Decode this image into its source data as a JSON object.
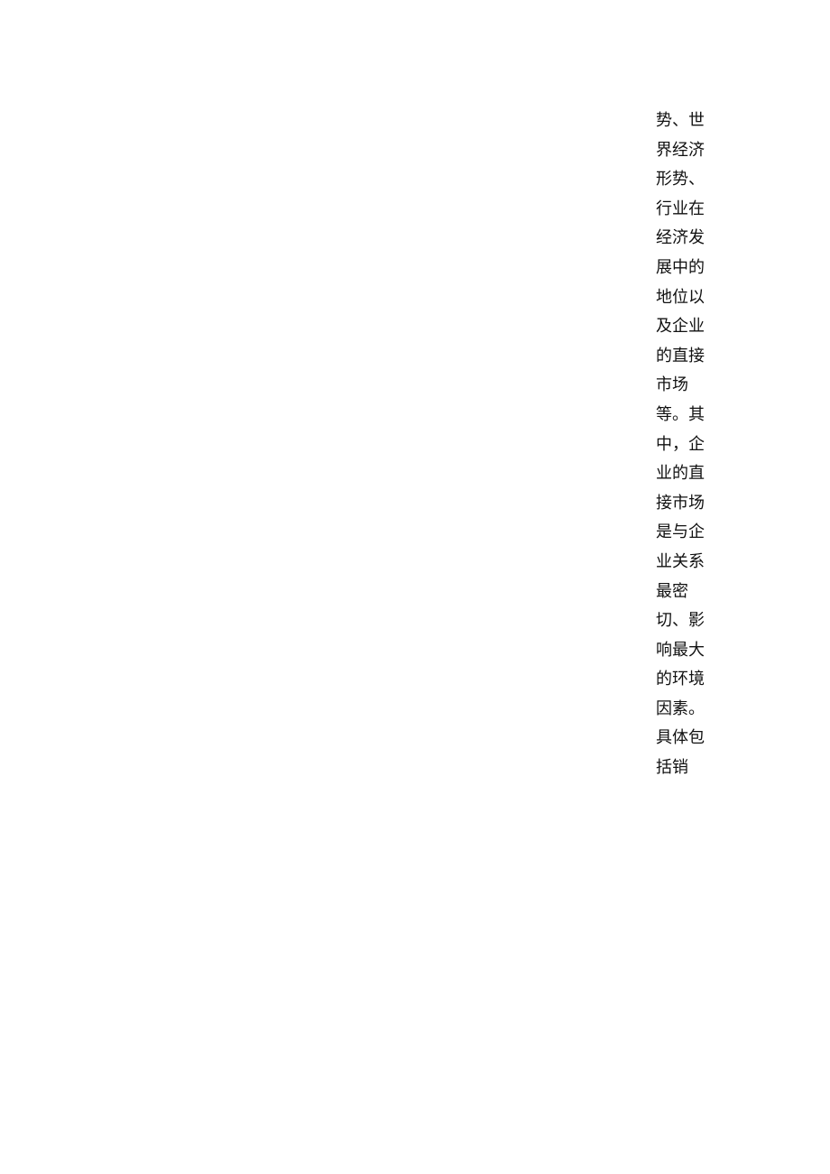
{
  "document": {
    "text_color": "#111111",
    "background_color": "#ffffff",
    "lines": [
      "势、世",
      "界经济",
      "形势、",
      "行业在",
      "经济发",
      "展中的",
      "地位以",
      "及企业",
      "的直接",
      "市场",
      "等。其",
      "中，企",
      "业的直",
      "接市场",
      "是与企",
      "业关系",
      "最密",
      "切、影",
      "响最大",
      "的环境",
      "因素。",
      "具体包",
      "括销"
    ]
  }
}
